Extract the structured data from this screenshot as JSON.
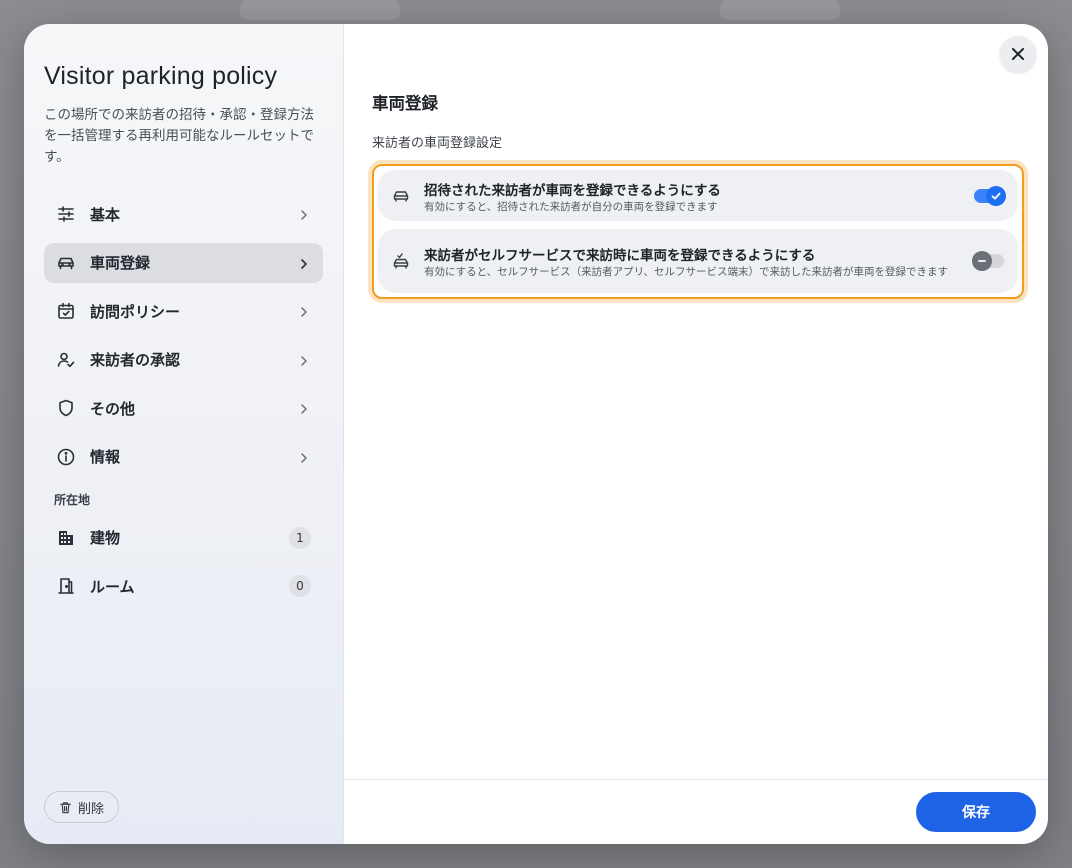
{
  "modal": {
    "title": "Visitor parking policy",
    "description": "この場所での来訪者の招待・承認・登録方法を一括管理する再利用可能なルールセットです。"
  },
  "nav": {
    "items": [
      {
        "label": "基本",
        "icon": "sliders-icon"
      },
      {
        "label": "車両登録",
        "icon": "car-icon",
        "active": true
      },
      {
        "label": "訪問ポリシー",
        "icon": "calendar-check-icon"
      },
      {
        "label": "来訪者の承認",
        "icon": "user-check-icon"
      },
      {
        "label": "その他",
        "icon": "shield-icon"
      },
      {
        "label": "情報",
        "icon": "info-icon"
      }
    ],
    "section_label": "所在地",
    "locations": [
      {
        "label": "建物",
        "icon": "building-icon",
        "count": "1"
      },
      {
        "label": "ルーム",
        "icon": "door-icon",
        "count": "0"
      }
    ]
  },
  "actions": {
    "delete_label": "削除",
    "save_label": "保存"
  },
  "content": {
    "heading": "車両登録",
    "subheading": "来訪者の車両登録設定",
    "settings": [
      {
        "title": "招待された来訪者が車両を登録できるようにする",
        "description": "有効にすると、招待された来訪者が自分の車両を登録できます",
        "enabled": true
      },
      {
        "title": "来訪者がセルフサービスで来訪時に車両を登録できるようにする",
        "description": "有効にすると、セルフサービス（来訪者アプリ、セルフサービス端末）で来訪した来訪者が車両を登録できます",
        "enabled": false
      }
    ]
  },
  "colors": {
    "accent": "#1e63e6",
    "highlight": "#f29c1f"
  }
}
